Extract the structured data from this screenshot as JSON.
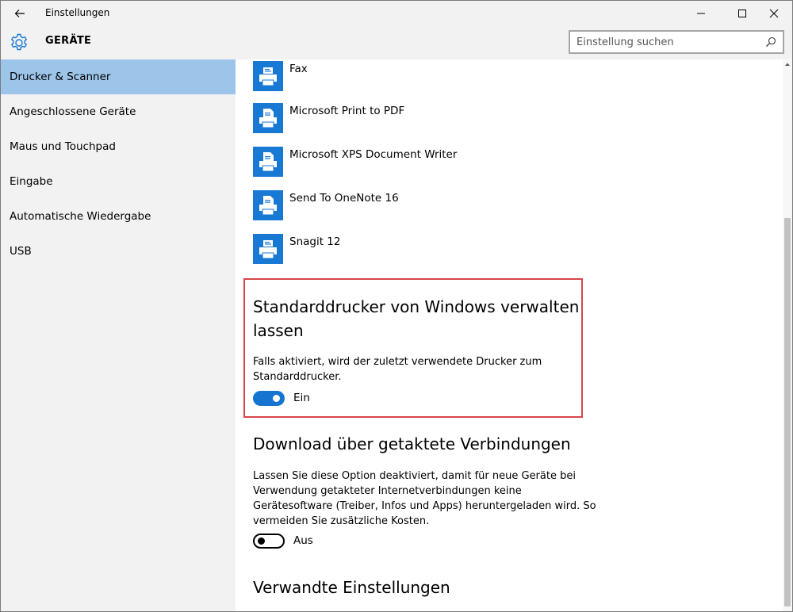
{
  "window": {
    "app_title": "Einstellungen",
    "section_title": "GERÄTE"
  },
  "search": {
    "placeholder": "Einstellung suchen"
  },
  "sidebar": {
    "items": [
      {
        "label": "Drucker & Scanner",
        "active": true
      },
      {
        "label": "Angeschlossene Geräte"
      },
      {
        "label": "Maus und Touchpad"
      },
      {
        "label": "Eingabe"
      },
      {
        "label": "Automatische Wiedergabe"
      },
      {
        "label": "USB"
      }
    ]
  },
  "printers": [
    {
      "name": "Fax",
      "icon": "fax-printer-icon"
    },
    {
      "name": "Microsoft Print to PDF",
      "icon": "document-printer-icon"
    },
    {
      "name": "Microsoft XPS Document Writer",
      "icon": "document-printer-icon"
    },
    {
      "name": "Send To OneNote 16",
      "icon": "document-printer-icon"
    },
    {
      "name": "Snagit 12",
      "icon": "fax-printer-icon"
    }
  ],
  "default_printer": {
    "title_line1": "Standarddrucker von Windows verwalten",
    "title_line2": "lassen",
    "desc_line1": "Falls aktiviert, wird der zuletzt verwendete Drucker zum",
    "desc_line2": "Standarddrucker.",
    "toggle_label": "Ein",
    "toggle_on": true
  },
  "metered": {
    "title": "Download über getaktete Verbindungen",
    "desc_line1": "Lassen Sie diese Option deaktiviert, damit für neue Geräte bei",
    "desc_line2": "Verwendung getakteter Internetverbindungen keine",
    "desc_line3": "Gerätesoftware (Treiber, Infos und Apps) heruntergeladen wird. So",
    "desc_line4": "vermeiden Sie zusätzliche Kosten.",
    "toggle_label": "Aus",
    "toggle_on": false
  },
  "related": {
    "title": "Verwandte Einstellungen"
  },
  "colors": {
    "accent": "#1779d4",
    "active_nav": "#9dc5ea",
    "highlight_border": "#d9454a"
  }
}
